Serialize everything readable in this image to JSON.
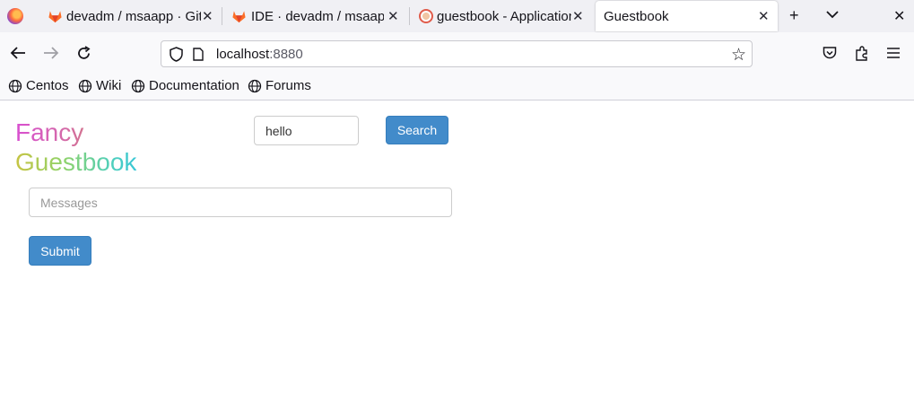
{
  "browser": {
    "tabs": [
      {
        "title": "devadm / msaapp · GitL",
        "favicon": "gitlab-icon"
      },
      {
        "title": "IDE · devadm / msaapp",
        "favicon": "gitlab-icon"
      },
      {
        "title": "guestbook - Application",
        "favicon": "guestbook-app-icon"
      },
      {
        "title": "Guestbook",
        "favicon": "none",
        "active": true
      }
    ],
    "url_host": "localhost",
    "url_port": ":8880"
  },
  "bookmarks": [
    {
      "label": "Centos",
      "icon": "globe-icon"
    },
    {
      "label": "Wiki",
      "icon": "globe-icon"
    },
    {
      "label": "Documentation",
      "icon": "globe-icon"
    },
    {
      "label": "Forums",
      "icon": "globe-icon"
    }
  ],
  "page": {
    "logo_line1": "Fancy",
    "logo_line2": "Guestbook",
    "search_value": "hello",
    "search_button": "Search",
    "messages_placeholder": "Messages",
    "submit_button": "Submit"
  },
  "colors": {
    "primary_button": "#428bca",
    "gitlab_orange": "#e24329"
  }
}
